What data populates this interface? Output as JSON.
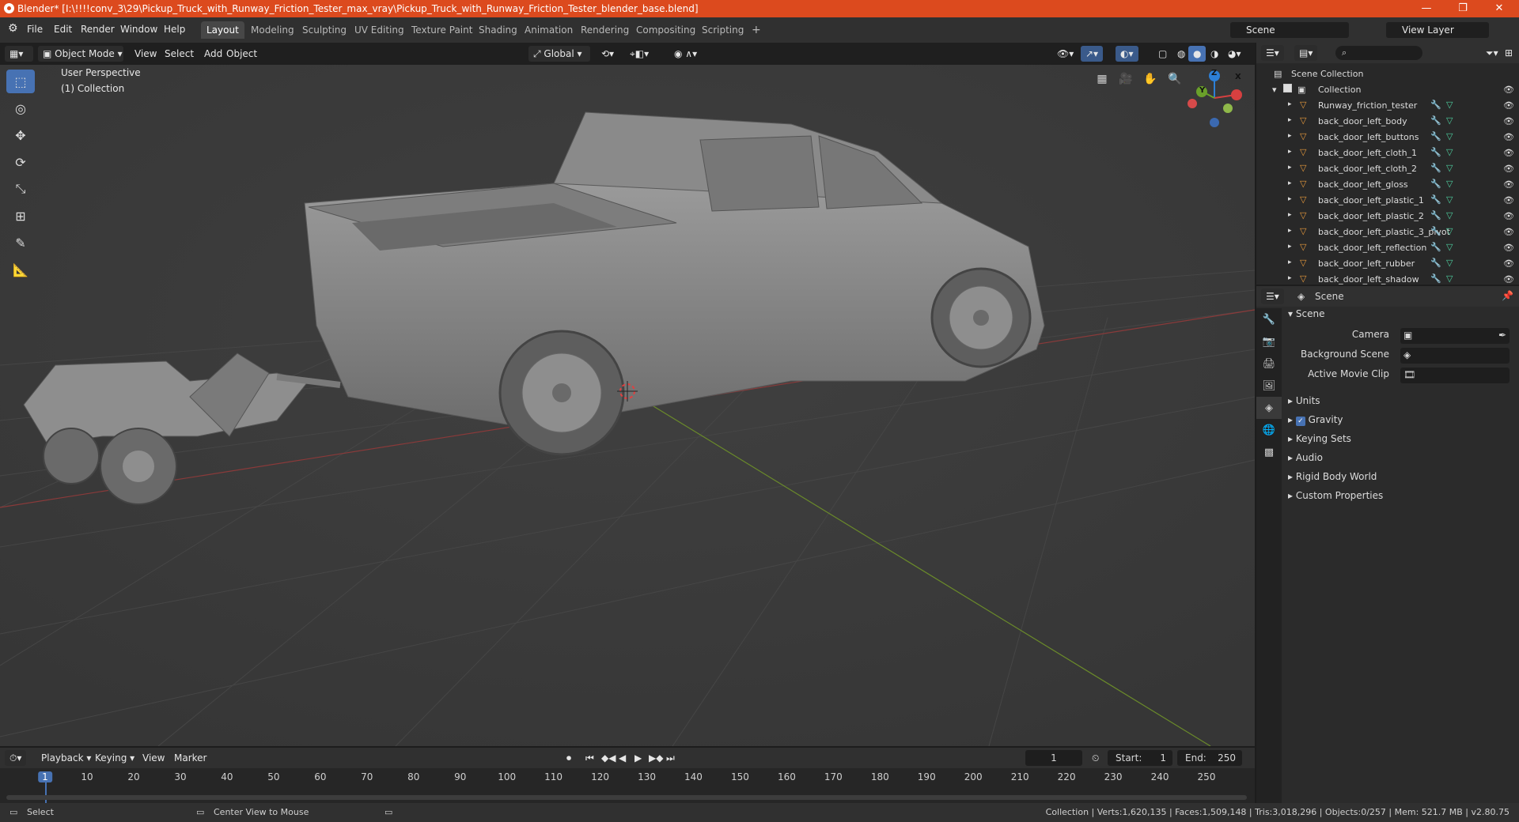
{
  "window": {
    "title": "Blender* [I:\\!!!!conv_3\\29\\Pickup_Truck_with_Runway_Friction_Tester_max_vray\\Pickup_Truck_with_Runway_Friction_Tester_blender_base.blend]",
    "minimize": "—",
    "maximize": "❐",
    "close": "✕"
  },
  "menu": {
    "items": [
      "File",
      "Edit",
      "Render",
      "Window",
      "Help"
    ]
  },
  "workspaces": [
    "Layout",
    "Modeling",
    "Sculpting",
    "UV Editing",
    "Texture Paint",
    "Shading",
    "Animation",
    "Rendering",
    "Compositing",
    "Scripting"
  ],
  "add_workspace": "+",
  "scene_selector": {
    "value": "Scene"
  },
  "view_layer_selector": {
    "value": "View Layer"
  },
  "viewport_header": {
    "mode": "Object Mode",
    "menus": [
      "View",
      "Select",
      "Add",
      "Object"
    ],
    "orientation": "Global"
  },
  "viewport": {
    "perspective_label": "User Perspective",
    "collection_label": "(1) Collection",
    "axis_x": "X",
    "axis_y": "Y",
    "axis_z": "Z"
  },
  "outliner": {
    "root": "Scene Collection",
    "collection": "Collection",
    "objects": [
      "Runway_friction_tester",
      "back_door_left_body",
      "back_door_left_buttons",
      "back_door_left_cloth_1",
      "back_door_left_cloth_2",
      "back_door_left_gloss",
      "back_door_left_plastic_1",
      "back_door_left_plastic_2",
      "back_door_left_plastic_3_pivot",
      "back_door_left_reflection",
      "back_door_left_rubber",
      "back_door_left_shadow"
    ]
  },
  "properties": {
    "header": "Scene",
    "panel_title": "Scene",
    "fields": [
      {
        "label": "Camera"
      },
      {
        "label": "Background Scene"
      },
      {
        "label": "Active Movie Clip"
      }
    ],
    "sections": [
      "Units",
      "Gravity",
      "Keying Sets",
      "Audio",
      "Rigid Body World",
      "Custom Properties"
    ],
    "gravity_checked": true
  },
  "timeline": {
    "menus": [
      "Playback",
      "Keying",
      "View",
      "Marker"
    ],
    "current_frame": "1",
    "start_label": "Start:",
    "start": "1",
    "end_label": "End:",
    "end": "250",
    "ticks": [
      "1",
      "10",
      "20",
      "30",
      "40",
      "50",
      "60",
      "70",
      "80",
      "90",
      "100",
      "110",
      "120",
      "130",
      "140",
      "150",
      "160",
      "170",
      "180",
      "190",
      "200",
      "210",
      "220",
      "230",
      "240",
      "250"
    ]
  },
  "statusbar": {
    "left_action": "Select",
    "mid_action": "Center View to Mouse",
    "stats": "Collection | Verts:1,620,135 | Faces:1,509,148 | Tris:3,018,296 | Objects:0/257 | Mem: 521.7 MB | v2.80.75"
  }
}
